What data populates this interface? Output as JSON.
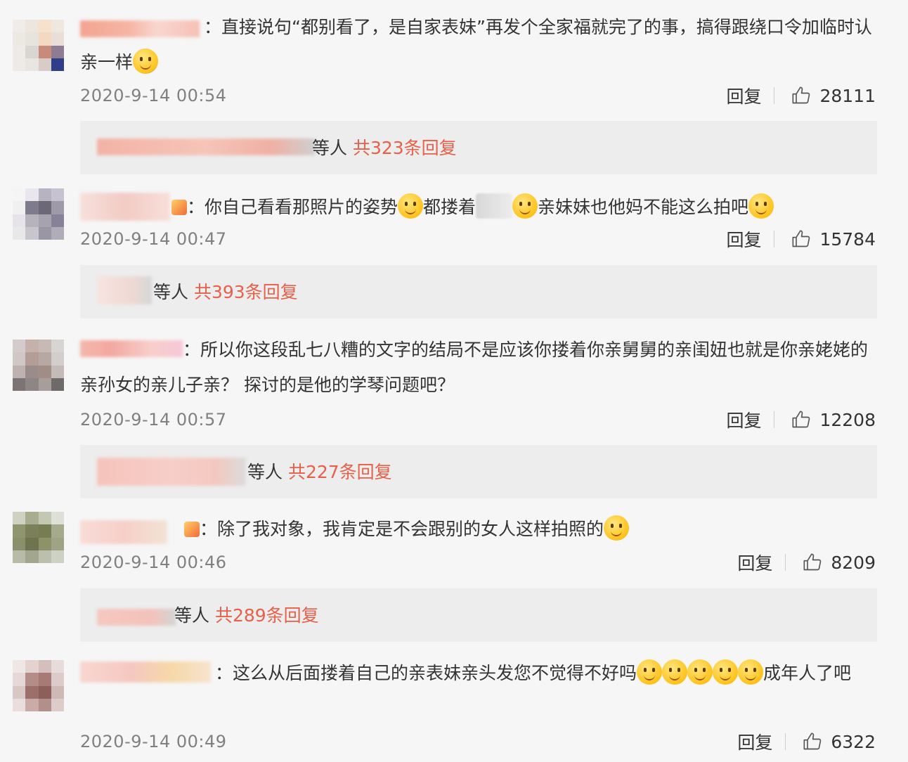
{
  "reply_label": "回复",
  "comments": [
    {
      "text_after": "直接说句“都别看了，是自家表妹”再发个全家福就完了的事，搞得跟绕口令加临时认亲一样",
      "time": "2020-9-14 00:54",
      "likes": "28111",
      "sub": {
        "suffix": "等人",
        "count": "共323条回复"
      }
    },
    {
      "text_a": "你自己看看那照片的姿势",
      "text_b": "都搂着",
      "text_c": "亲妹妹也他妈不能这么拍吧",
      "time": "2020-9-14 00:47",
      "likes": "15784",
      "sub": {
        "suffix": "等人",
        "count": "共393条回复"
      }
    },
    {
      "text_after": "所以你这段乱七八糟的文字的结局不是应该你搂着你亲舅舅的亲闺妞也就是你亲姥姥的亲孙女的亲儿子亲？ 探讨的是他的学琴问题吧？",
      "time": "2020-9-14 00:57",
      "likes": "12208",
      "sub": {
        "suffix": "等人",
        "count": "共227条回复"
      }
    },
    {
      "text_after": "除了我对象，我肯定是不会跟别的女人这样拍照的",
      "time": "2020-9-14 00:46",
      "likes": "8209",
      "sub": {
        "suffix": "等人",
        "count": "共289条回复"
      }
    },
    {
      "text_after": "这么从后面搂着自己的亲表妹亲头发您不觉得不好吗",
      "text_end": "成年人了吧",
      "time": "2020-9-14 00:49",
      "likes": "6322"
    }
  ]
}
